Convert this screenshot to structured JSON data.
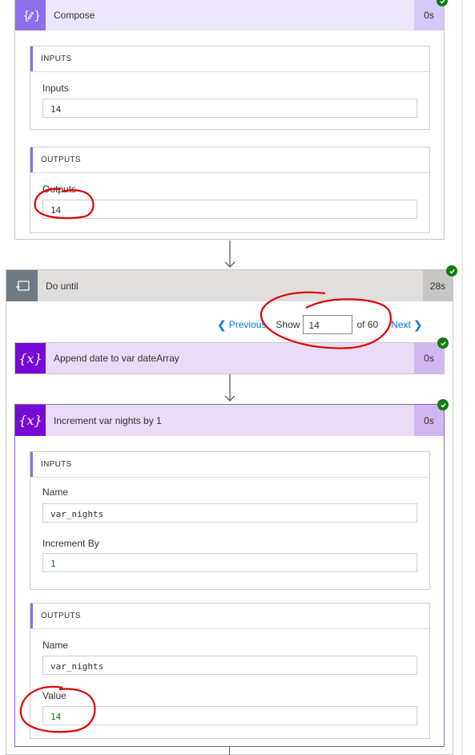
{
  "compose": {
    "title": "Compose",
    "duration": "0s",
    "inputs_section": "INPUTS",
    "inputs_label": "Inputs",
    "inputs_value": "14",
    "outputs_section": "OUTPUTS",
    "outputs_label": "Outputs",
    "outputs_value": "14"
  },
  "do_until": {
    "title": "Do until",
    "duration": "28s",
    "pagination": {
      "previous_label": "Previous",
      "show_label": "Show",
      "current_value": "14",
      "of_label": "of 60",
      "next_label": "Next"
    }
  },
  "append_action": {
    "title": "Append date to var dateArray",
    "duration": "0s"
  },
  "increment_action": {
    "title": "Increment var nights by 1",
    "duration": "0s",
    "inputs_section": "INPUTS",
    "name_label": "Name",
    "name_value": "var_nights",
    "increment_label": "Increment By",
    "increment_value": "1",
    "outputs_section": "OUTPUTS",
    "out_name_label": "Name",
    "out_name_value": "var_nights",
    "value_label": "Value",
    "value_value": "14"
  },
  "colors": {
    "compose_accent": "#8c6ee8",
    "variable_accent": "#770bd6",
    "loop_accent": "#486991",
    "success": "#107c10",
    "annotation": "#e00000"
  }
}
